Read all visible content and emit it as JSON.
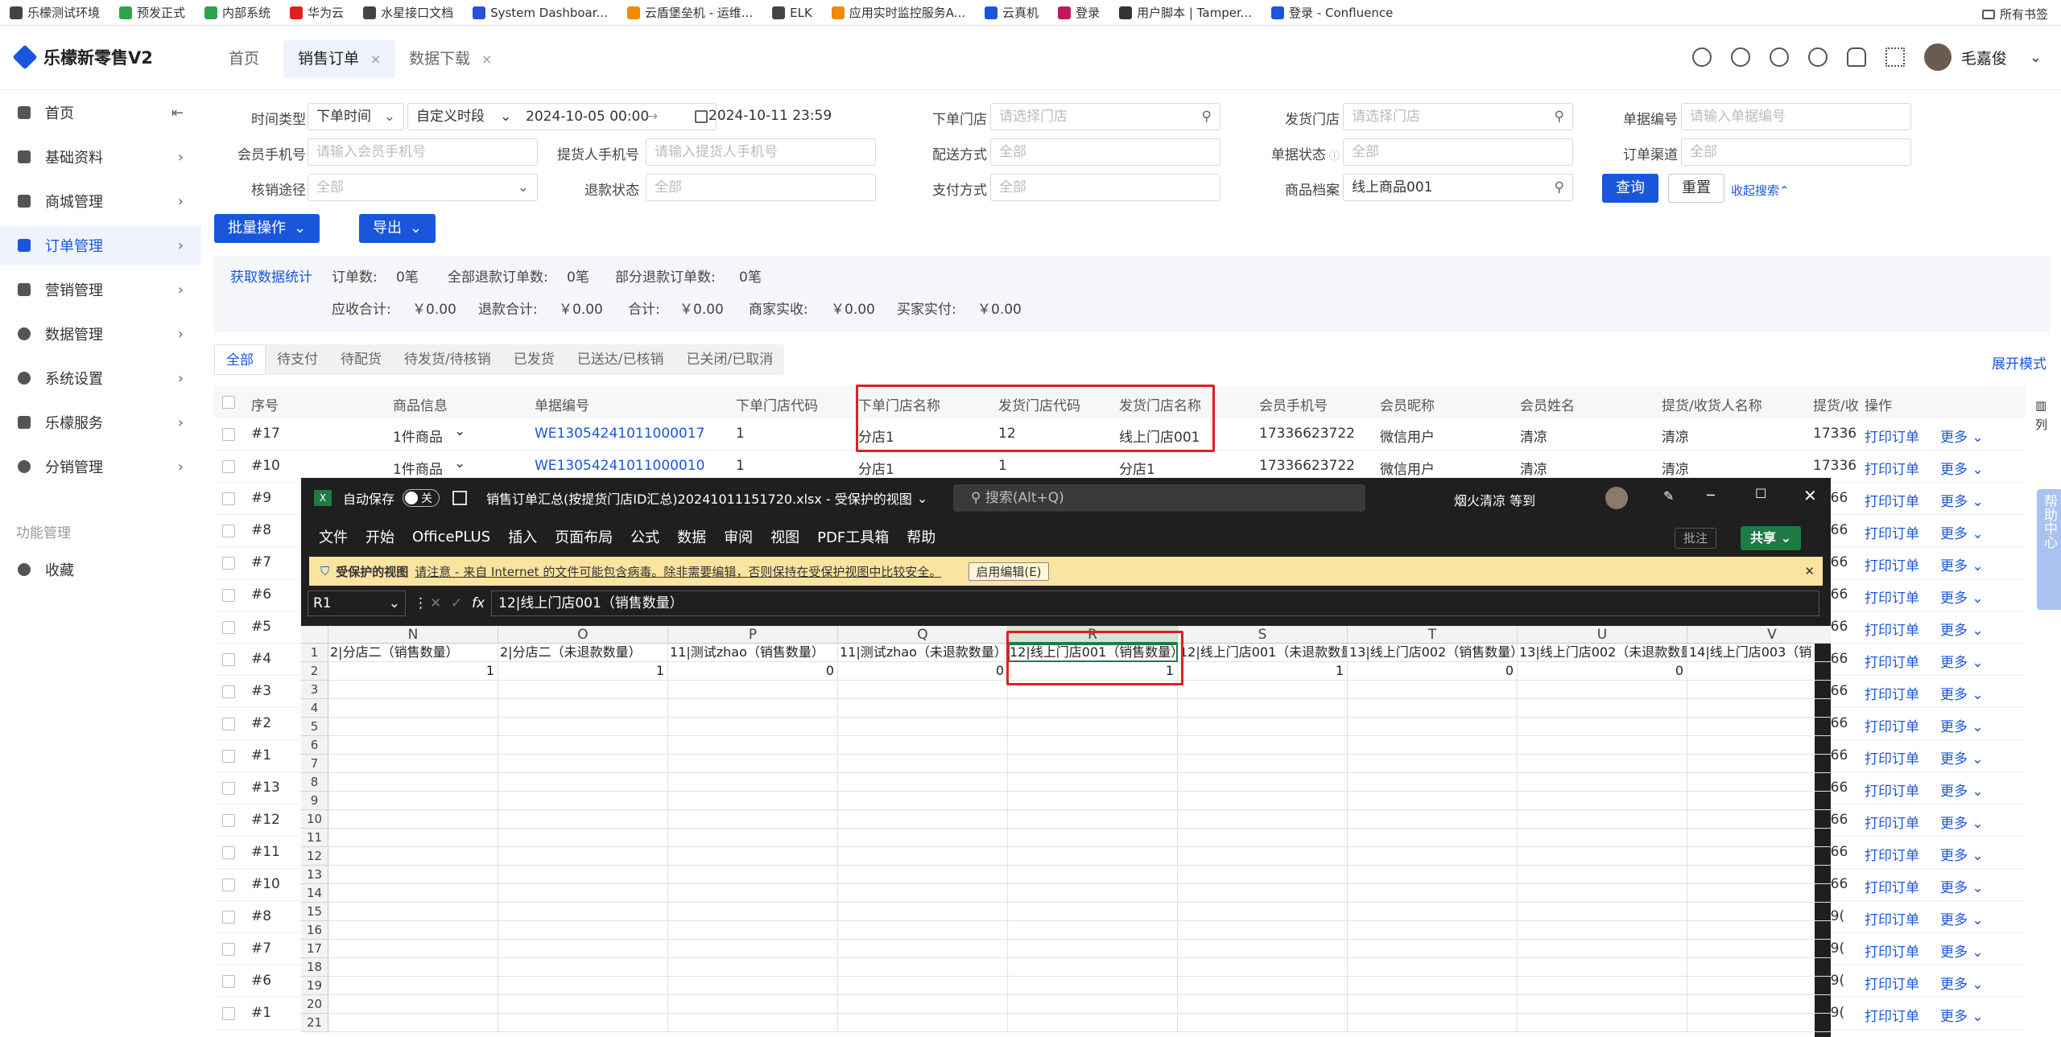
{
  "bookmarks": [
    {
      "label": "乐檬测试环境",
      "color": "#444444"
    },
    {
      "label": "预发正式",
      "color": "#2da44e"
    },
    {
      "label": "内部系统",
      "color": "#2da44e"
    },
    {
      "label": "华为云",
      "color": "#e02020"
    },
    {
      "label": "水星接口文档",
      "color": "#444444"
    },
    {
      "label": "System Dashboar...",
      "color": "#2b4fd8"
    },
    {
      "label": "云盾堡垒机 - 运维...",
      "color": "#f08a00"
    },
    {
      "label": "ELK",
      "color": "#444444"
    },
    {
      "label": "应用实时监控服务A...",
      "color": "#f08a00"
    },
    {
      "label": "云真机",
      "color": "#1a56db"
    },
    {
      "label": "登录",
      "color": "#c2185b"
    },
    {
      "label": "用户脚本 | Tamper...",
      "color": "#333333"
    },
    {
      "label": "登录 - Confluence",
      "color": "#1a56db"
    }
  ],
  "bookmarks_right": "所有书签",
  "app": {
    "title": "乐檬新零售V2"
  },
  "tabs": [
    {
      "label": "首页",
      "close": ""
    },
    {
      "label": "销售订单",
      "close": "×"
    },
    {
      "label": "数据下载",
      "close": "×"
    }
  ],
  "user": {
    "name": "毛嘉俊"
  },
  "sidebar": {
    "items": [
      {
        "label": "首页",
        "arrow": "⇤"
      },
      {
        "label": "基础资料",
        "arrow": "›"
      },
      {
        "label": "商城管理",
        "arrow": "›"
      },
      {
        "label": "订单管理",
        "arrow": "›"
      },
      {
        "label": "营销管理",
        "arrow": "›"
      },
      {
        "label": "数据管理",
        "arrow": "›"
      },
      {
        "label": "系统设置",
        "arrow": "›"
      },
      {
        "label": "乐檬服务",
        "arrow": "›"
      },
      {
        "label": "分销管理",
        "arrow": "›"
      }
    ],
    "section": "功能管理",
    "fav": "收藏"
  },
  "filters": {
    "time_type_label": "时间类型",
    "time_type": "下单时间",
    "period": "自定义时段",
    "date_from": "2024-10-05 00:00",
    "date_arrow": "→",
    "date_to": "2024-10-11 23:59",
    "order_store_label": "下单门店",
    "order_store_ph": "请选择门店",
    "ship_store_label": "发货门店",
    "ship_store_ph": "请选择门店",
    "bill_no_label": "单据编号",
    "bill_no_ph": "请输入单据编号",
    "member_phone_label": "会员手机号",
    "member_phone_ph": "请输入会员手机号",
    "pickup_phone_label": "提货人手机号",
    "pickup_phone_ph": "请输入提货人手机号",
    "delivery_label": "配送方式",
    "delivery_val": "全部",
    "bill_state_label": "单据状态",
    "bill_state_val": "全部",
    "channel_label": "订单渠道",
    "channel_val": "全部",
    "writeoff_label": "核销途径",
    "writeoff_val": "全部",
    "refund_label": "退款状态",
    "refund_val": "全部",
    "pay_label": "支付方式",
    "pay_val": "全部",
    "product_label": "商品档案",
    "product_val": "线上商品001",
    "query": "查询",
    "reset": "重置",
    "collapse": "收起搜索"
  },
  "actions": {
    "batch": "批量操作",
    "export": "导出"
  },
  "stats": {
    "fetch": "获取数据统计",
    "order_count_label": "订单数:",
    "order_count": "0笔",
    "full_refund_label": "全部退款订单数:",
    "full_refund": "0笔",
    "part_refund_label": "部分退款订单数:",
    "part_refund": "0笔",
    "receivable_label": "应收合计:",
    "receivable": "￥0.00",
    "refund_total_label": "退款合计:",
    "refund_total": "￥0.00",
    "total_label": "合计:",
    "total": "￥0.00",
    "merchant_label": "商家实收:",
    "merchant": "￥0.00",
    "buyer_label": "买家实付:",
    "buyer": "￥0.00"
  },
  "status_tabs": [
    "全部",
    "待支付",
    "待配货",
    "待发货/待核销",
    "已发货",
    "已送达/已核销",
    "已关闭/已取消"
  ],
  "expand_mode": "展开模式",
  "col_setting": "列",
  "table": {
    "headers": [
      "序号",
      "商品信息",
      "单据编号",
      "下单门店代码",
      "下单门店名称",
      "发货门店代码",
      "发货门店名称",
      "会员手机号",
      "会员昵称",
      "会员姓名",
      "提货/收货人名称",
      "提货/收",
      "操作"
    ],
    "rows": [
      {
        "no": "#17",
        "goods": "1件商品",
        "bill": "WE13054241011000017",
        "ocode": "1",
        "oname": "分店1",
        "scode": "12",
        "sname": "线上门店001",
        "phone": "17336623722",
        "nick": "微信用户",
        "name": "清凉",
        "recv": "清凉",
        "recv2": "17336"
      },
      {
        "no": "#10",
        "goods": "1件商品",
        "bill": "WE13054241011000010",
        "ocode": "1",
        "oname": "分店1",
        "scode": "1",
        "sname": "分店1",
        "phone": "17336623722",
        "nick": "微信用户",
        "name": "清凉",
        "recv": "清凉",
        "recv2": "17336"
      },
      {
        "no": "#9",
        "recv2": "3366"
      },
      {
        "no": "#8",
        "recv2": "3366"
      },
      {
        "no": "#7",
        "recv2": "3366"
      },
      {
        "no": "#6",
        "recv2": "3366"
      },
      {
        "no": "#5",
        "recv2": "3366"
      },
      {
        "no": "#4",
        "recv2": "3366"
      },
      {
        "no": "#3",
        "recv2": "3366"
      },
      {
        "no": "#2",
        "recv2": "3366"
      },
      {
        "no": "#1",
        "recv2": "3366"
      },
      {
        "no": "#13",
        "recv2": "3366"
      },
      {
        "no": "#12",
        "recv2": "3366"
      },
      {
        "no": "#11",
        "recv2": "3366"
      },
      {
        "no": "#10",
        "recv2": "3366"
      },
      {
        "no": "#8",
        "recv2": "189("
      },
      {
        "no": "#7",
        "recv2": "189("
      },
      {
        "no": "#6",
        "recv2": "189("
      },
      {
        "no": "#1",
        "recv2": "189("
      }
    ],
    "print": "打印订单",
    "more": "更多"
  },
  "excel": {
    "autosave": "自动保存",
    "toggle": "关",
    "filename": "销售订单汇总(按提货门店ID汇总)20241011151720.xlsx - 受保护的视图",
    "search": "搜索(Alt+Q)",
    "user": "烟火清凉 等到",
    "menu": [
      "文件",
      "开始",
      "OfficePLUS",
      "插入",
      "页面布局",
      "公式",
      "数据",
      "审阅",
      "视图",
      "PDF工具箱",
      "帮助"
    ],
    "comment": "批注",
    "share": "共享",
    "protected_title": "受保护的视图",
    "protected_msg": "请注意 - 来自 Internet 的文件可能包含病毒。除非需要编辑，否则保持在受保护视图中比较安全。",
    "enable_edit": "启用编辑(E)",
    "namebox": "R1",
    "fx": "fx",
    "formula": "12|线上门店001（销售数量）",
    "columns": [
      "N",
      "O",
      "P",
      "Q",
      "R",
      "S",
      "T",
      "U",
      "V"
    ],
    "row1": [
      "2|分店二（销售数量）",
      "2|分店二（未退款数量）",
      "11|测试zhao（销售数量）",
      "11|测试zhao（未退款数量）",
      "12|线上门店001（销售数量）",
      "12|线上门店001（未退款数量）",
      "13|线上门店002（销售数量）",
      "13|线上门店002（未退款数量）",
      "14|线上门店003（销"
    ],
    "row2": [
      "1",
      "1",
      "0",
      "0",
      "1",
      "1",
      "0",
      "0",
      ""
    ],
    "row_numbers": [
      "1",
      "2",
      "3",
      "4",
      "5",
      "6",
      "7",
      "8",
      "9",
      "10",
      "11",
      "12",
      "13",
      "14",
      "15",
      "16",
      "17",
      "18",
      "19",
      "20",
      "21"
    ]
  },
  "help": "帮助中心"
}
